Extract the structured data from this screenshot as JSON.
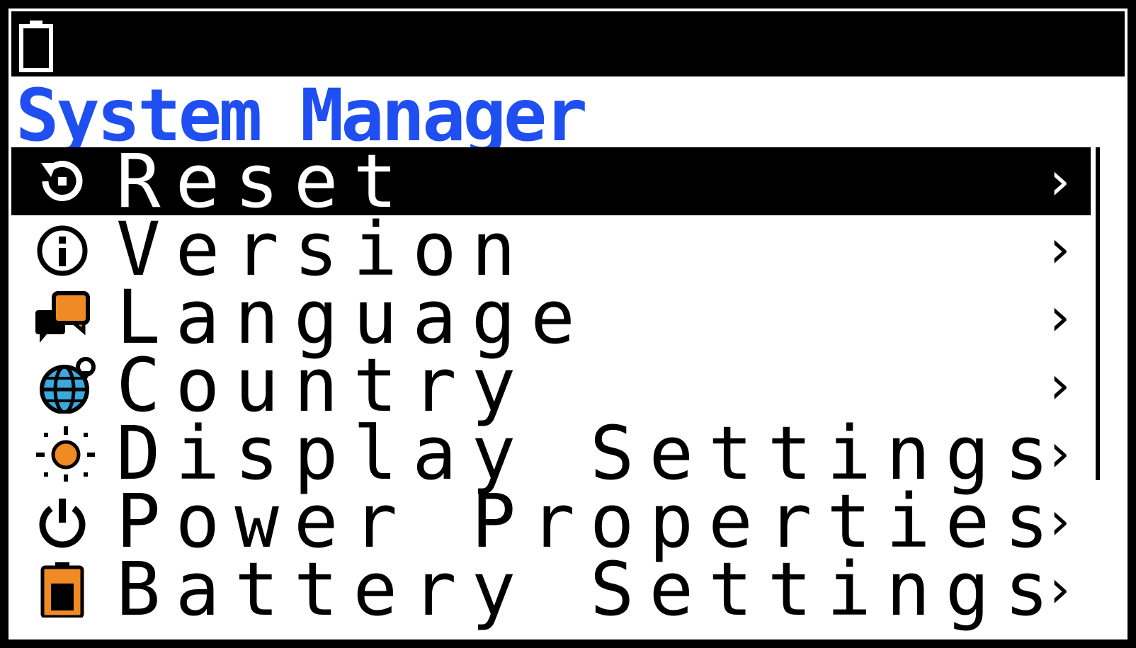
{
  "screen": {
    "title": "System Manager",
    "accent_color": "#1f4ff0",
    "icon_color": "#f08a24"
  },
  "statusbar": {
    "battery_icon": "battery-icon"
  },
  "menu": {
    "items": [
      {
        "label": "Reset",
        "icon": "reset-icon",
        "selected": true
      },
      {
        "label": "Version",
        "icon": "info-icon",
        "selected": false
      },
      {
        "label": "Language",
        "icon": "speech-bubbles-icon",
        "selected": false
      },
      {
        "label": "Country",
        "icon": "globe-pin-icon",
        "selected": false
      },
      {
        "label": "Display Settings",
        "icon": "sun-icon",
        "selected": false
      },
      {
        "label": "Power Properties",
        "icon": "power-icon",
        "selected": false
      },
      {
        "label": "Battery Settings",
        "icon": "battery-orange-icon",
        "selected": false
      }
    ],
    "chevron": "›"
  }
}
